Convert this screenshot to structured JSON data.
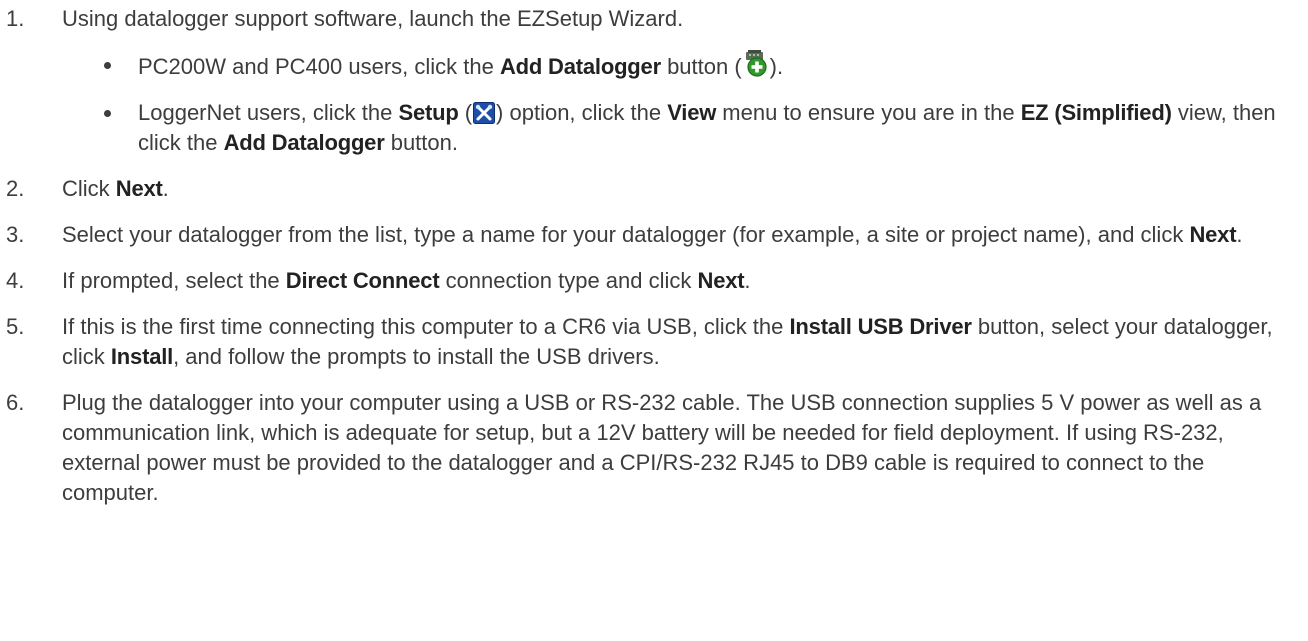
{
  "steps": [
    {
      "num": "1.",
      "t1": "Using datalogger support software, launch the EZSetup Wizard.",
      "bullets": [
        {
          "a": "PC200W and PC400 users, click the ",
          "b": "Add Datalogger",
          "c": " button (",
          "icon": "add-datalogger-icon",
          "d": ")."
        },
        {
          "a": "LoggerNet users, click the ",
          "b": "Setup",
          "c": " (",
          "icon": "setup-icon",
          "d": ") option, click the ",
          "e": "View",
          "f": " menu to ensure you are in the ",
          "g": "EZ (Simplified)",
          "h": " view, then click the ",
          "i": "Add Datalogger",
          "j": " button."
        }
      ]
    },
    {
      "num": "2.",
      "t1": "Click ",
      "b1": "Next",
      "t2": "."
    },
    {
      "num": "3.",
      "t1": "Select your datalogger from the list, type a name for your datalogger (for example, a site or project name), and click ",
      "b1": "Next",
      "t2": "."
    },
    {
      "num": "4.",
      "t1": "If prompted, select the ",
      "b1": "Direct Connect",
      "t2": " connection type and click ",
      "b2": "Next",
      "t3": "."
    },
    {
      "num": "5.",
      "t1": "If this is the first time connecting this computer to a CR6 via USB, click the ",
      "b1": "Install USB Driver",
      "t2": " button, select your datalogger, click ",
      "b2": "Install",
      "t3": ", and follow the prompts to install the USB drivers."
    },
    {
      "num": "6.",
      "t1": "Plug the datalogger into your computer using a USB or RS-232 cable. The USB connection supplies 5 V power as well as a communication link, which is adequate for setup, but a 12V battery will be needed for field deployment. If using RS-232, external power must be provided to the datalogger and a CPI/RS-232 RJ45 to DB9 cable is required to connect to the computer."
    }
  ],
  "colors": {
    "text": "#3d3d3d",
    "icon_green": "#2f9a2a",
    "icon_blue": "#1e4fa8"
  }
}
